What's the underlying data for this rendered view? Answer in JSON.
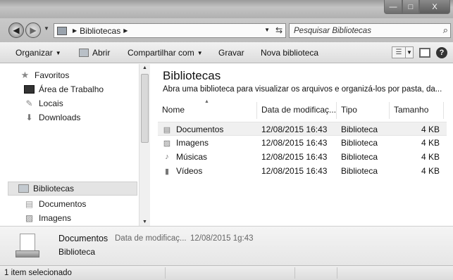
{
  "window": {
    "min_glyph": "—",
    "max_glyph": "□",
    "close_glyph": "X"
  },
  "address": {
    "crumb": "Bibliotecas",
    "search_placeholder": "Pesquisar Bibliotecas"
  },
  "toolbar": {
    "organize": "Organizar",
    "open": "Abrir",
    "share": "Compartilhar com",
    "burn": "Gravar",
    "new_library": "Nova biblioteca",
    "help": "?"
  },
  "navpane": {
    "favorites": "Favoritos",
    "desktop": "Área de Trabalho",
    "places": "Locais",
    "downloads": "Downloads",
    "libraries": "Bibliotecas",
    "documents": "Documentos",
    "images": "Imagens"
  },
  "content": {
    "title": "Bibliotecas",
    "description": "Abra uma biblioteca para visualizar os arquivos e organizá-los por pasta, da...",
    "columns": {
      "name": "Nome",
      "date": "Data de modificaç...",
      "type": "Tipo",
      "size": "Tamanho"
    },
    "rows": [
      {
        "name": "Documentos",
        "date": "12/08/2015 16:43",
        "type": "Biblioteca",
        "size": "4 KB"
      },
      {
        "name": "Imagens",
        "date": "12/08/2015 16:43",
        "type": "Biblioteca",
        "size": "4 KB"
      },
      {
        "name": "Músicas",
        "date": "12/08/2015 16:43",
        "type": "Biblioteca",
        "size": "4 KB"
      },
      {
        "name": "Vídeos",
        "date": "12/08/2015 16:43",
        "type": "Biblioteca",
        "size": "4 KB"
      }
    ]
  },
  "details": {
    "name": "Documentos",
    "label": "Data de modificaç...",
    "value": "12/08/2015 1g:43",
    "type": "Biblioteca"
  },
  "status": {
    "text": "1 item selecionado"
  }
}
